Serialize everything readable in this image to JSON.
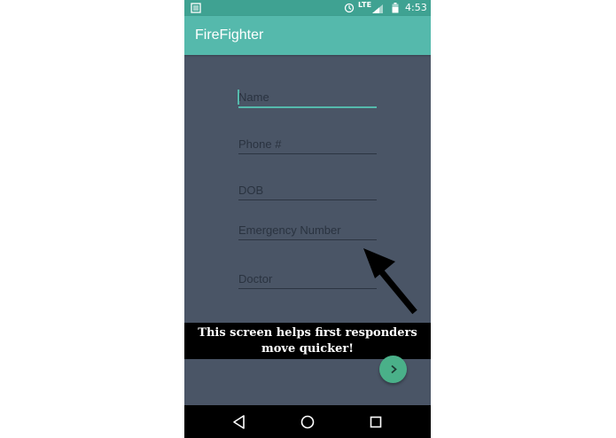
{
  "status_bar": {
    "network": "LTE",
    "time": "4:53"
  },
  "app_bar": {
    "title": "FireFighter"
  },
  "form": {
    "fields": [
      {
        "hint": "Name",
        "focused": true
      },
      {
        "hint": "Phone #"
      },
      {
        "hint": "DOB"
      },
      {
        "hint": "Emergency Number"
      },
      {
        "hint": "Doctor"
      }
    ]
  },
  "caption": {
    "line1": "This screen helps first responders",
    "line2": "move quicker!"
  },
  "icons": {
    "notification": "news-icon",
    "sync": "sync-icon",
    "signal": "cell-signal-icon",
    "battery": "battery-icon",
    "fab": "chevron-right-icon",
    "back": "back-triangle-icon",
    "home": "home-circle-icon",
    "recent": "recent-apps-square-icon"
  },
  "colors": {
    "status_bar": "#3fa292",
    "app_bar": "#55b9ac",
    "background": "#4a5566",
    "accent": "#55b9ac",
    "fab": "#4ab089"
  }
}
